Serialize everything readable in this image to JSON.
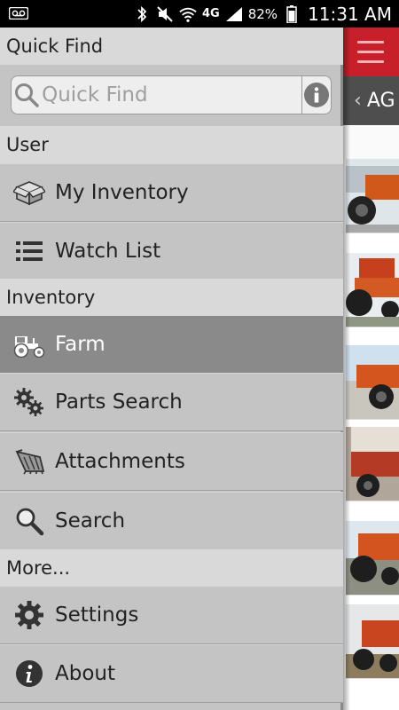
{
  "status_bar": {
    "network": "4G",
    "battery": "82%",
    "time": "11:31 AM"
  },
  "background_app": {
    "subbar_title": "AG"
  },
  "drawer": {
    "quick_find": {
      "header": "Quick Find",
      "placeholder": "Quick Find"
    },
    "sections": {
      "user": "User",
      "inventory": "Inventory",
      "more": "More..."
    },
    "items": {
      "my_inventory": "My Inventory",
      "watch_list": "Watch List",
      "farm": "Farm",
      "parts_search": "Parts Search",
      "attachments": "Attachments",
      "search": "Search",
      "settings": "Settings",
      "about": "About"
    },
    "active_item": "Farm"
  },
  "colors": {
    "brand_red": "#c8202a",
    "drawer_bg": "#c4c4c4",
    "active_item_bg": "#8a8a8a"
  }
}
